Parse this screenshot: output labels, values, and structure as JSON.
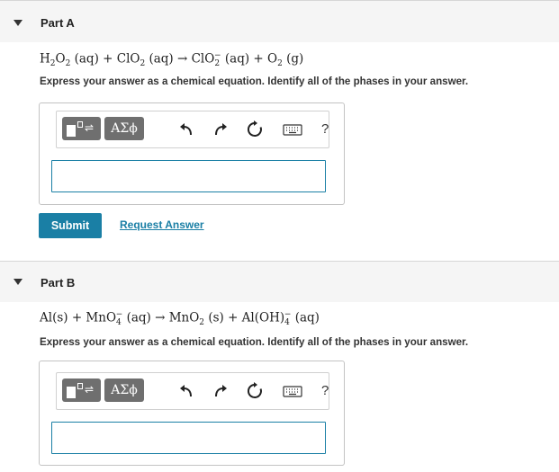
{
  "partA": {
    "title": "Part A",
    "equation": {
      "lhs1": "H",
      "lhs1_sub1": "2",
      "lhs1_mid": "O",
      "lhs1_sub2": "2",
      "lhs1_phase": " (aq) + ClO",
      "lhs2_sub": "2",
      "lhs2_phase": " (aq) → ClO",
      "rhs1_sub": "2",
      "rhs1_sup": "−",
      "rhs1_phase": " (aq)  +  O",
      "rhs2_sub": "2",
      "rhs2_phase": " (g)"
    },
    "instruction": "Express your answer as a chemical equation. Identify all of the phases in your answer.",
    "greek_label": "ΑΣϕ",
    "help_label": "?",
    "input_value": "",
    "submit_label": "Submit",
    "request_label": "Request Answer"
  },
  "partB": {
    "title": "Part B",
    "equation": {
      "t1": "Al(s) + MnO",
      "t1_sub": "4",
      "t1_sup": "−",
      "t2": " (aq) → MnO",
      "t2_sub": "2",
      "t3": " (s)  +  Al(OH)",
      "t3_sub": "4",
      "t3_sup": "−",
      "t4": " (aq)"
    },
    "instruction": "Express your answer as a chemical equation. Identify all of the phases in your answer.",
    "greek_label": "ΑΣϕ",
    "help_label": "?",
    "input_value": ""
  },
  "icons": [
    "template-icon",
    "greek-symbols-icon",
    "undo-icon",
    "redo-icon",
    "reset-icon",
    "keyboard-icon",
    "help-icon"
  ]
}
